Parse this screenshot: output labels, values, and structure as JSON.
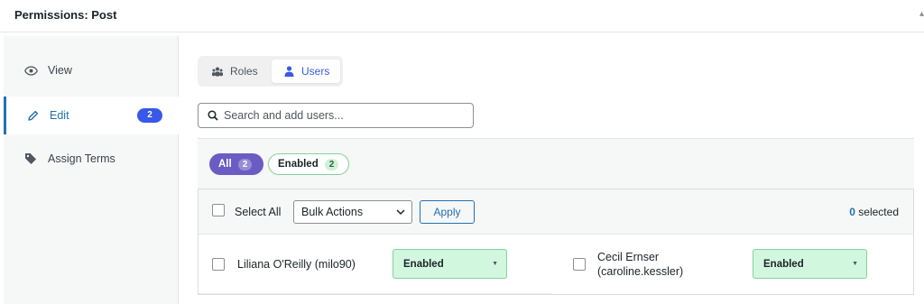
{
  "panel": {
    "title": "Permissions: Post"
  },
  "sidebar": {
    "items": [
      {
        "label": "View",
        "icon": "eye-icon"
      },
      {
        "label": "Edit",
        "icon": "pencil-icon",
        "badge": "2",
        "active": true
      },
      {
        "label": "Assign Terms",
        "icon": "tag-icon"
      }
    ]
  },
  "tabs": [
    {
      "label": "Roles",
      "icon": "group-icon"
    },
    {
      "label": "Users",
      "icon": "user-icon",
      "active": true
    }
  ],
  "search": {
    "placeholder": "Search and add users..."
  },
  "filters": {
    "all": {
      "label": "All",
      "count": "2"
    },
    "enabled": {
      "label": "Enabled",
      "count": "2"
    }
  },
  "toolbar": {
    "select_all_label": "Select All",
    "bulk_actions": "Bulk Actions",
    "apply_label": "Apply",
    "selected_count": "0",
    "selected_suffix": "selected"
  },
  "users": [
    {
      "name_line1": "Liliana O'Reilly (milo90)",
      "name_line2": "",
      "status": "Enabled"
    },
    {
      "name_line1": "Cecil Ernser",
      "name_line2": "(caroline.kessler)",
      "status": "Enabled"
    }
  ],
  "colors": {
    "accent": "#3858e9",
    "link": "#2271b1",
    "all_pill": "#6b5cc4",
    "enabled_bg": "#d1f7df",
    "enabled_border": "#86d19a"
  }
}
